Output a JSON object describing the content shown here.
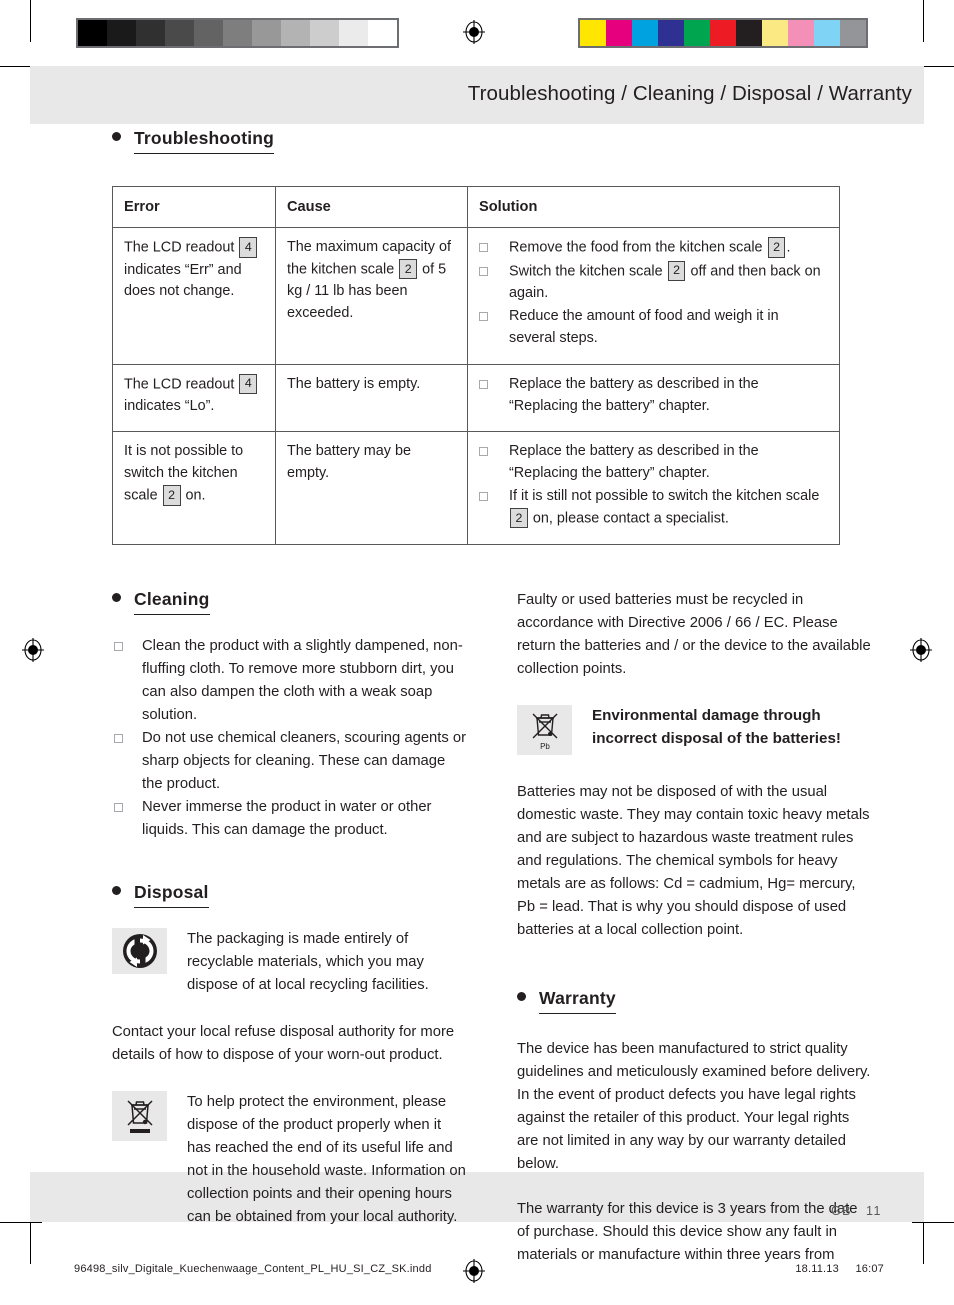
{
  "header": {
    "title": "Troubleshooting / Cleaning / Disposal / Warranty"
  },
  "footer": {
    "language": "GB",
    "page_number": "11",
    "filename": "96498_silv_Digitale_Kuechenwaage_Content_PL_HU_SI_CZ_SK.indd",
    "date": "18.11.13",
    "time": "16:07"
  },
  "calibration": {
    "grayscale": [
      "#000000",
      "#1a1a1a",
      "#303030",
      "#4a4a4a",
      "#636363",
      "#7e7e7e",
      "#989898",
      "#b3b3b3",
      "#cdcdcd",
      "#ebebeb",
      "#ffffff"
    ],
    "colors": [
      "#ffe600",
      "#e6007e",
      "#00a3e0",
      "#2e3192",
      "#00a550",
      "#ed1c24",
      "#231f20",
      "#fbe983",
      "#f48fb8",
      "#7fd4f5",
      "#939598"
    ]
  },
  "sections": {
    "troubleshooting": {
      "heading": "Troubleshooting",
      "table": {
        "headers": [
          "Error",
          "Cause",
          "Solution"
        ],
        "rows": [
          {
            "error": [
              {
                "t": "The LCD readout "
              },
              {
                "ref": "4"
              },
              {
                "t": " indicates “Err” and does not change."
              }
            ],
            "cause": [
              {
                "t": "The maximum capacity of the kitchen scale "
              },
              {
                "ref": "2"
              },
              {
                "t": " of 5 kg / 11 lb has been exceeded."
              }
            ],
            "solution": [
              [
                {
                  "t": "Remove the food from the kitchen scale "
                },
                {
                  "ref": "2"
                },
                {
                  "t": "."
                }
              ],
              [
                {
                  "t": "Switch the kitchen scale "
                },
                {
                  "ref": "2"
                },
                {
                  "t": " off and then back on again."
                }
              ],
              [
                {
                  "t": "Reduce the amount of food and weigh it in several steps."
                }
              ]
            ]
          },
          {
            "error": [
              {
                "t": "The LCD readout "
              },
              {
                "ref": "4"
              },
              {
                "t": " indicates “Lo”."
              }
            ],
            "cause": [
              {
                "t": "The battery is empty."
              }
            ],
            "solution": [
              [
                {
                  "t": "Replace the battery as described in the “Replacing the battery” chapter."
                }
              ]
            ]
          },
          {
            "error": [
              {
                "t": "It is not possible to switch the kitchen scale "
              },
              {
                "ref": "2"
              },
              {
                "t": " on."
              }
            ],
            "cause": [
              {
                "t": "The battery may be empty."
              }
            ],
            "solution": [
              [
                {
                  "t": "Replace the battery as described in the “Replacing the battery” chapter."
                }
              ],
              [
                {
                  "t": "If it is still not possible to switch the kitchen scale "
                },
                {
                  "ref": "2"
                },
                {
                  "t": " on, please contact a specialist."
                }
              ]
            ]
          }
        ]
      }
    },
    "cleaning": {
      "heading": "Cleaning",
      "bullets": [
        "Clean the product with a slightly dampened, non-fluffing cloth. To remove more stubborn dirt, you can also dampen the cloth with a weak soap solution.",
        "Do not use chemical cleaners, scouring agents or sharp objects for cleaning. These can damage the product.",
        "Never immerse the product in water or other liquids. This can damage the product."
      ]
    },
    "disposal": {
      "heading": "Disposal",
      "packaging_text": "The packaging is made entirely of recyclable materials, which you may dispose of at local recycling facilities.",
      "refuse_text": "Contact your local refuse disposal authority for more details of how to dispose of your worn-out product.",
      "weee_text": "To help protect the environment, please dispose of the product properly when it has reached the end of its useful life and not in the household waste. Information on collection points and their opening hours can be obtained from your local authority."
    },
    "batteries": {
      "recycle_text": "Faulty or used batteries must be recycled in accordance with Directive 2006 / 66 / EC. Please return the batteries and / or the device to the available collection points.",
      "warning_heading": "Environmental damage through incorrect disposal of the batteries!",
      "battery_icon_label": "Pb",
      "heavy_metals_text": "Batteries may not be disposed of with the usual domestic waste. They may contain toxic heavy metals and are subject to hazardous waste treatment rules and regulations. The chemical symbols for heavy metals are as follows: Cd = cadmium, Hg= mercury, Pb = lead. That is why you should dispose of used batteries at a local collection point."
    },
    "warranty": {
      "heading": "Warranty",
      "paragraph1": "The device has been manufactured to strict quality guidelines and meticulously examined before delivery. In the event of product defects you have legal rights against the retailer of this product. Your legal rights are not limited in any way by our warranty detailed below.",
      "paragraph2": "The warranty for this device is 3 years from the date of purchase. Should this device show any fault in materials or manufacture within three years from"
    }
  }
}
